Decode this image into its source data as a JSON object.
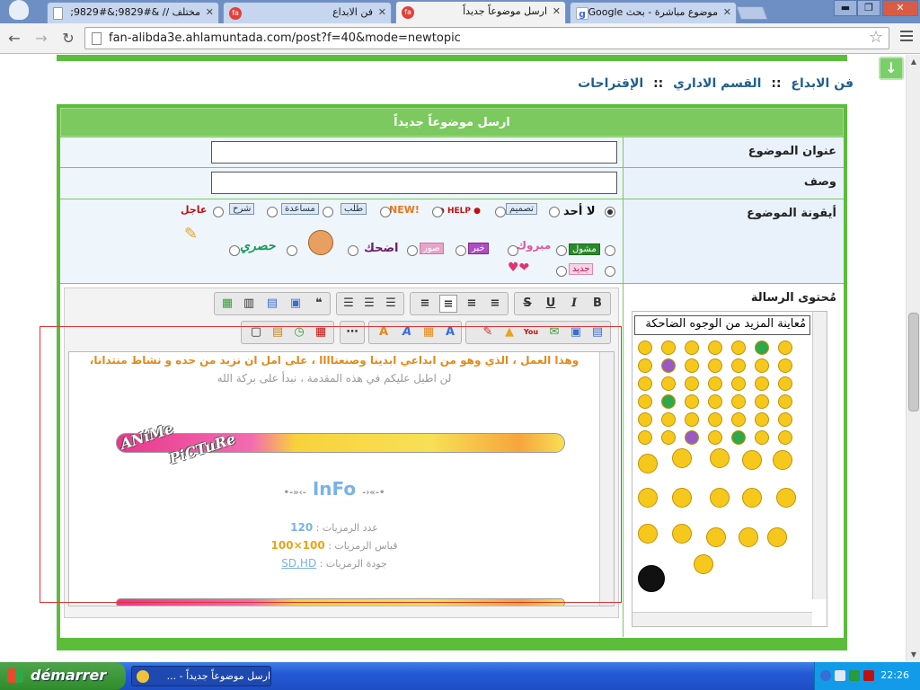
{
  "browser": {
    "tabs": [
      {
        "label": "مختلف // &#9829;&#9829;",
        "favicon": "doc-icon",
        "active": false
      },
      {
        "label": "فن الابداع",
        "favicon": "site-icon",
        "active": false
      },
      {
        "label": "ارسل موضوعاً جديداً",
        "favicon": "site-icon",
        "active": true
      },
      {
        "label": "موضوع مباشرة - بحث Google",
        "favicon": "google-icon",
        "active": false
      }
    ],
    "url": "fan-alibda3e.ahlamuntada.com/post?f=40&mode=newtopic",
    "window_buttons": {
      "minimize": "▬",
      "maximize": "❐",
      "close": "✕"
    }
  },
  "page": {
    "breadcrumb": [
      "فن الابداع",
      "القسم الاداري",
      "الإقتراحات"
    ],
    "breadcrumb_sep": "::",
    "form_title": "ارسل موضوعاً جديداً",
    "fields": {
      "subject_label": "عنوان الموضوع",
      "description_label": "وصف",
      "topic_icon_label": "أيقونة الموضوع",
      "message_label": "مُحتوى الرسالة"
    },
    "topic_icons": {
      "none": "لا أحد",
      "design": "تصميم",
      "help": "HELP",
      "new": "NEW!",
      "request": "طلب",
      "assist": "مساعدة",
      "explain": "شرح",
      "urgent": "عاجل",
      "solved": "مشول",
      "congrats": "مبروك",
      "news": "خبر",
      "photos": "صور",
      "laugh": "اضحك",
      "exclusive": "حصري",
      "new2": "جديد"
    },
    "editor": {
      "toolbar_row1": [
        "B",
        "I",
        "U",
        "S"
      ],
      "content_line1": "وهذا العمل ، الذي وهو من ابداعي ابدينا وصنعناااا ، على امل ان نزيد من حده و نشاط منتدانا،",
      "content_line2": "لن اطيل عليكم في هذه المقدمة ، نبدأ على بركة الله",
      "banner_text_1": "ANiMe",
      "banner_text_2": "PiCTuRe",
      "info_title": "InFo",
      "info_count_label": "عدد الرمزيات :",
      "info_count_value": "120",
      "info_size_label": "قياس الرمزيات :",
      "info_size_value": "100×100",
      "info_quality_label": "جودة الرمزيات :",
      "info_quality_value": "SD,HD"
    },
    "smilies": {
      "title": "مُعاينة المزيد من الوجوه الضاحكة"
    }
  },
  "taskbar": {
    "start_label": "démarrer",
    "task_label": "ارسل موضوعاً جديداً - ...",
    "clock": "22:26"
  },
  "colors": {
    "accent_green": "#5bbd3a",
    "header_green": "#7cc95f",
    "link_blue": "#1f5f8f"
  }
}
